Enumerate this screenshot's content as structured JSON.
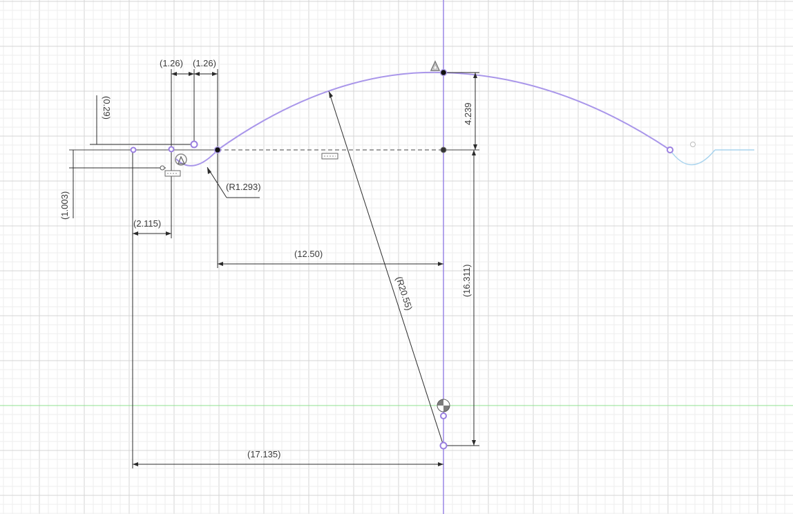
{
  "sketch": {
    "dimensions": {
      "d_126_left": "(1.26)",
      "d_126_right": "(1.26)",
      "d_029": "(0.29)",
      "d_1003": "(1.003)",
      "d_2115": "(2.115)",
      "d_r1293": "(R1.293)",
      "d_1250": "(12.50)",
      "d_4239": "4.239",
      "d_16311": "(16.311)",
      "d_r2055": "(R20.55)",
      "d_17135": "(17.135)"
    },
    "colors": {
      "grid_minor": "#ededed",
      "grid_major": "#d4d4d4",
      "x_axis": "#8fe08f",
      "y_axis": "#9a86e6",
      "sketch_curve": "#a996ea",
      "construction_curve": "#a9d4ee",
      "dimension": "#2b2b2b"
    },
    "icons": [
      "tangent-constraint-icon",
      "horizontal-constraint-icon",
      "fix-constraint-icon",
      "origin-icon"
    ]
  }
}
